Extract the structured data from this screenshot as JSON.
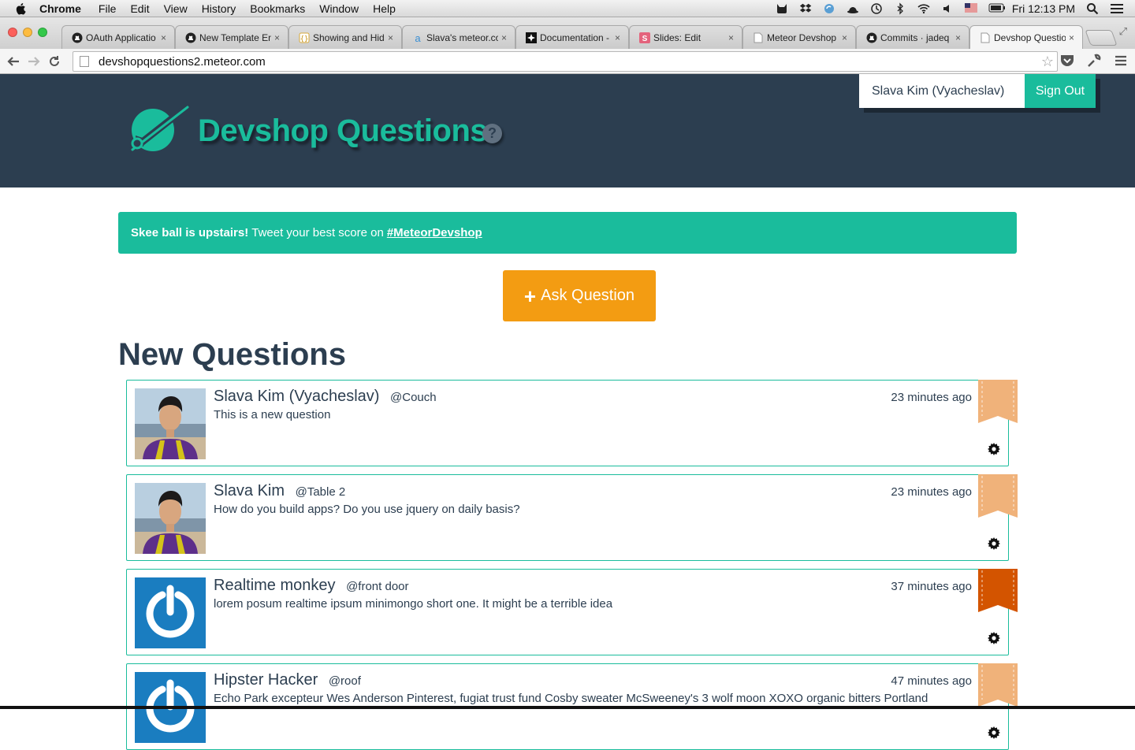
{
  "menubar": {
    "app": "Chrome",
    "items": [
      "File",
      "Edit",
      "View",
      "History",
      "Bookmarks",
      "Window",
      "Help"
    ],
    "clock": "Fri 12:13 PM",
    "status_icons": [
      "cat-icon",
      "dropbox-icon",
      "sync-icon",
      "bowler-hat-icon",
      "time-machine-icon",
      "bluetooth-icon",
      "wifi-icon",
      "volume-icon",
      "us-flag-icon",
      "battery-icon",
      "spotlight-icon",
      "notification-center-icon"
    ]
  },
  "tabs": [
    {
      "title": "OAuth Applicatio",
      "favicon": "github-icon"
    },
    {
      "title": "New Template En",
      "favicon": "github-icon"
    },
    {
      "title": "Showing and Hid",
      "favicon": "jsfiddle-icon"
    },
    {
      "title": "Slava's meteor.co",
      "favicon": "atmosphere-icon"
    },
    {
      "title": "Documentation -",
      "favicon": "meteor-star-icon"
    },
    {
      "title": "Slides: Edit",
      "favicon": "slides-icon"
    },
    {
      "title": "Meteor Devshop",
      "favicon": "page-icon"
    },
    {
      "title": "Commits · jadeq",
      "favicon": "github-icon"
    },
    {
      "title": "Devshop Questio",
      "favicon": "page-icon",
      "active": true
    }
  ],
  "toolbar": {
    "url": "devshopquestions2.meteor.com"
  },
  "header": {
    "title": "Devshop Questions",
    "help": "?",
    "user_name": "Slava Kim (Vyacheslav)",
    "signout_label": "Sign Out"
  },
  "alert": {
    "strong": "Skee ball is upstairs!",
    "text": "Tweet your best score on",
    "link": "#MeteorDevshop"
  },
  "ask_button": {
    "icon": "+",
    "label": "Ask Question"
  },
  "section_title": "New Questions",
  "questions": [
    {
      "name": "Slava Kim (Vyacheslav)",
      "location": "@Couch",
      "text": "This is a new question",
      "time": "23 minutes ago",
      "avatar": "photo",
      "bookmarked": false
    },
    {
      "name": "Slava Kim",
      "location": "@Table 2",
      "text": "How do you build apps? Do you use jquery on daily basis?",
      "time": "23 minutes ago",
      "avatar": "photo",
      "bookmarked": false
    },
    {
      "name": "Realtime monkey",
      "location": "@front door",
      "text": "lorem posum realtime ipsum minimongo short one. It might be a terrible idea",
      "time": "37 minutes ago",
      "avatar": "power-logo",
      "bookmarked": true
    },
    {
      "name": "Hipster Hacker",
      "location": "@roof",
      "text": "Echo Park excepteur Wes Anderson Pinterest, fugiat trust fund Cosby sweater McSweeney's 3 wolf moon XOXO organic bitters Portland",
      "time": "47 minutes ago",
      "avatar": "power-logo",
      "bookmarked": false
    }
  ],
  "colors": {
    "header_bg": "#2c3e50",
    "accent": "#1abc9c",
    "ask_button": "#f39c12",
    "bookmark_off": "#f0b27a",
    "bookmark_on": "#d35400"
  }
}
